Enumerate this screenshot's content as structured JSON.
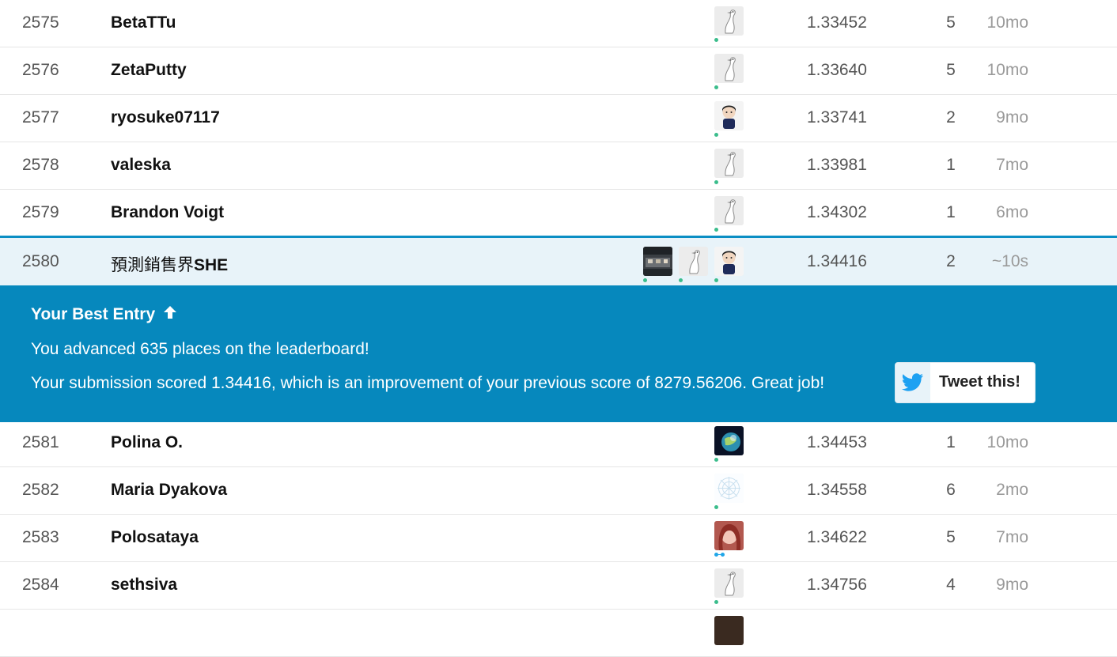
{
  "rows_above": [
    {
      "rank": "2575",
      "name": "BetaTTu",
      "avatar": "goose-avatar",
      "score": "1.33452",
      "entries": "5",
      "last": "10mo"
    },
    {
      "rank": "2576",
      "name": "ZetaPutty",
      "avatar": "goose-avatar",
      "score": "1.33640",
      "entries": "5",
      "last": "10mo"
    },
    {
      "rank": "2577",
      "name": "ryosuke07117",
      "avatar": "person-avatar",
      "score": "1.33741",
      "entries": "2",
      "last": "9mo"
    },
    {
      "rank": "2578",
      "name": "valeska",
      "avatar": "goose-avatar",
      "score": "1.33981",
      "entries": "1",
      "last": "7mo"
    },
    {
      "rank": "2579",
      "name": "Brandon Voigt",
      "avatar": "goose-avatar",
      "score": "1.34302",
      "entries": "1",
      "last": "6mo"
    }
  ],
  "my_row": {
    "rank": "2580",
    "name_cjk": "預測銷售界",
    "name_latin": "SHE",
    "team_avatars": [
      "photo-avatar",
      "goose-avatar",
      "person-avatar"
    ],
    "score": "1.34416",
    "entries": "2",
    "last": "~10s"
  },
  "banner": {
    "title": "Your Best Entry",
    "title_icon": "arrow-up-icon",
    "line1": "You advanced 635 places on the leaderboard!",
    "line2": "Your submission scored 1.34416, which is an improvement of your previous score of 8279.56206. Great job!",
    "tweet_label": "Tweet this!",
    "tweet_icon": "twitter-bird-icon"
  },
  "rows_below": [
    {
      "rank": "2581",
      "name": "Polina O.",
      "avatar": "planet-avatar",
      "score": "1.34453",
      "entries": "1",
      "last": "10mo"
    },
    {
      "rank": "2582",
      "name": "Maria Dyakova",
      "avatar": "snowflake-avatar",
      "score": "1.34558",
      "entries": "6",
      "last": "2mo"
    },
    {
      "rank": "2583",
      "name": "Polosataya",
      "avatar": "portrait-avatar",
      "score": "1.34622",
      "entries": "5",
      "last": "7mo"
    },
    {
      "rank": "2584",
      "name": "sethsiva",
      "avatar": "goose-avatar",
      "score": "1.34756",
      "entries": "4",
      "last": "9mo"
    }
  ],
  "colors": {
    "accent": "#20beff",
    "banner": "#0688bd",
    "highlight_row": "#e8f3f9",
    "online_dot": "#3bbd8c"
  }
}
